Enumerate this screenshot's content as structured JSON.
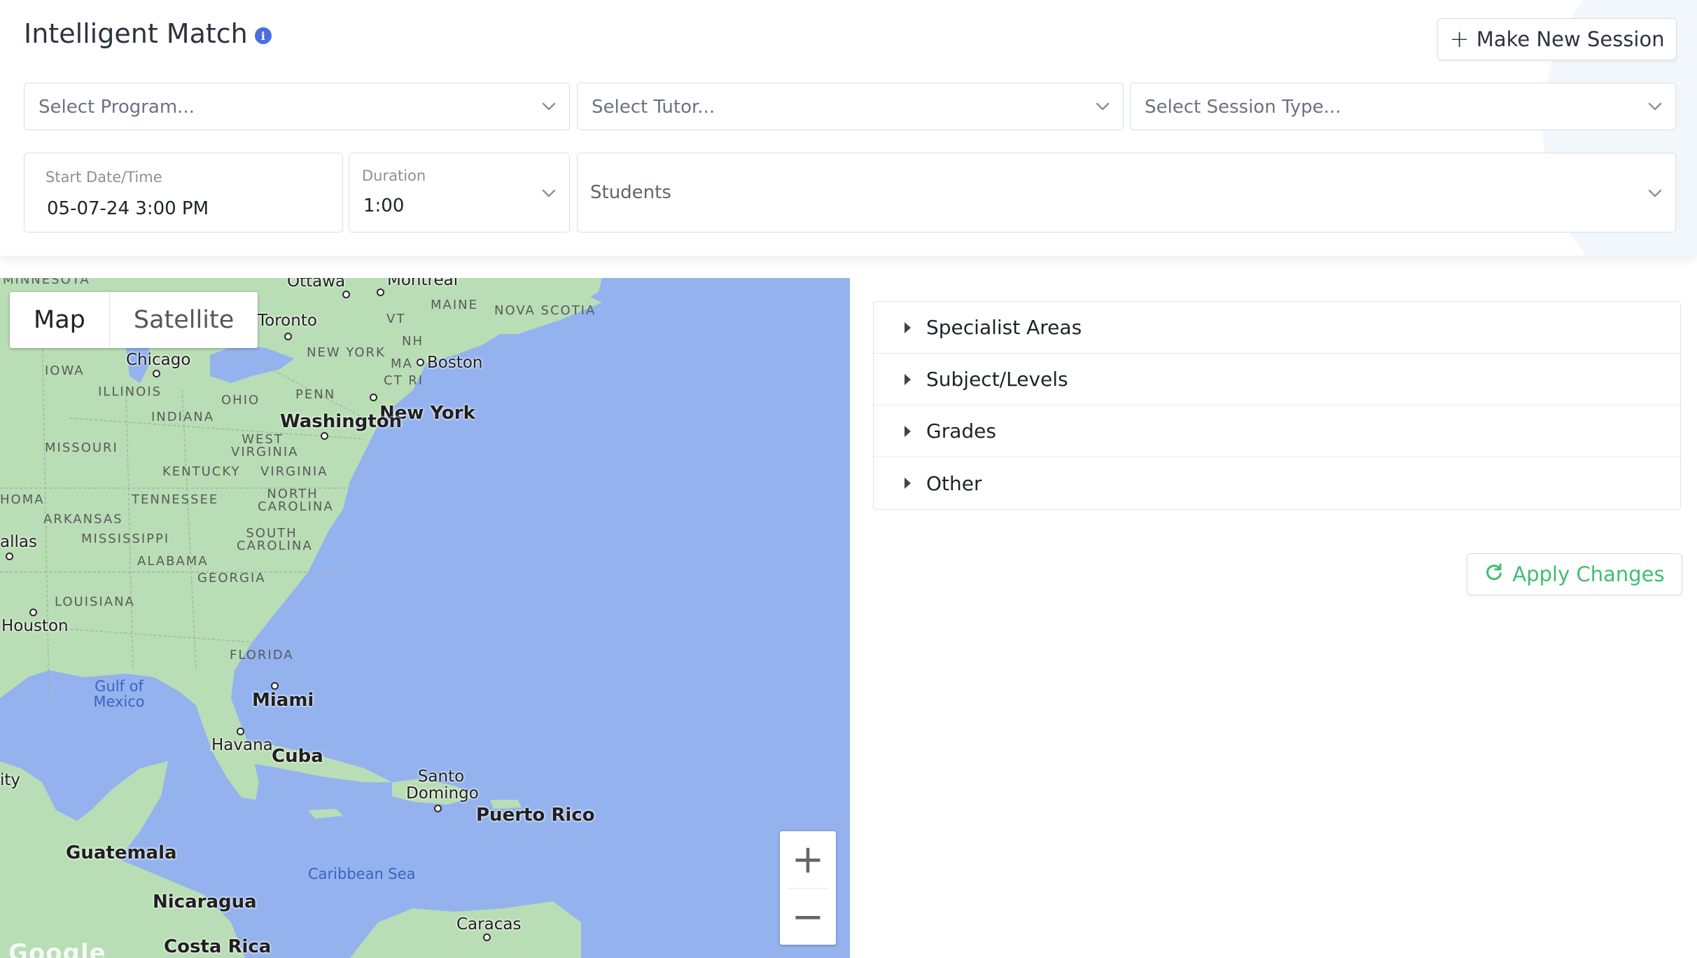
{
  "header": {
    "title": "Intelligent Match",
    "info_icon": "i",
    "new_session_plus": "+",
    "new_session_label": "Make New Session"
  },
  "form": {
    "program_placeholder": "Select Program...",
    "tutor_placeholder": "Select Tutor...",
    "session_type_placeholder": "Select Session Type...",
    "start_label": "Start Date/Time",
    "start_value": "05-07-24 3:00 PM",
    "duration_label": "Duration",
    "duration_value": "1:00",
    "students_placeholder": "Students"
  },
  "map": {
    "toggle_map": "Map",
    "toggle_satellite": "Satellite",
    "zoom_in": "+",
    "zoom_out": "−",
    "attribution": "Google",
    "labels": {
      "minnesota": "MINNESOTA",
      "ottawa": "Ottawa",
      "montreal": "Montreal",
      "toronto": "Toronto",
      "maine": "MAINE",
      "vt": "VT",
      "nova_scotia": "NOVA SCOTIA",
      "nh": "NH",
      "new_york_state": "NEW YORK",
      "ma": "MA",
      "boston": "Boston",
      "ct_ri": "CT RI",
      "chicago": "Chicago",
      "iowa": "IOWA",
      "illinois": "ILLINOIS",
      "ohio": "OHIO",
      "penn": "PENN",
      "new_york_city": "New York",
      "indiana": "INDIANA",
      "washington": "Washington",
      "missouri": "MISSOURI",
      "west_virginia": "WEST VIRGINIA",
      "kentucky": "KENTUCKY",
      "virginia": "VIRGINIA",
      "oklahoma": "HOMA",
      "tennessee": "TENNESSEE",
      "north_carolina": "NORTH CAROLINA",
      "arkansas": "ARKANSAS",
      "mississippi": "MISSISSIPPI",
      "south_carolina": "SOUTH CAROLINA",
      "dallas": "allas",
      "alabama": "ALABAMA",
      "georgia": "GEORGIA",
      "louisiana": "LOUISIANA",
      "houston": "Houston",
      "florida": "FLORIDA",
      "gulf_of_mexico": "Gulf of Mexico",
      "miami": "Miami",
      "havana": "Havana",
      "cuba": "Cuba",
      "santo_domingo": "Santo Domingo",
      "puerto_rico": "Puerto Rico",
      "city_edge": "ity",
      "guatemala": "Guatemala",
      "caribbean_sea": "Caribbean Sea",
      "nicaragua": "Nicaragua",
      "caracas": "Caracas",
      "costa_rica": "Costa Rica"
    }
  },
  "filters": {
    "items": [
      {
        "label": "Specialist Areas"
      },
      {
        "label": "Subject/Levels"
      },
      {
        "label": "Grades"
      },
      {
        "label": "Other"
      }
    ],
    "apply_label": "Apply Changes"
  },
  "colors": {
    "apply_green": "#3fbf6a",
    "water": "#94b2ee",
    "land": "#b9ddb5",
    "info_blue": "#4a6ee0"
  }
}
